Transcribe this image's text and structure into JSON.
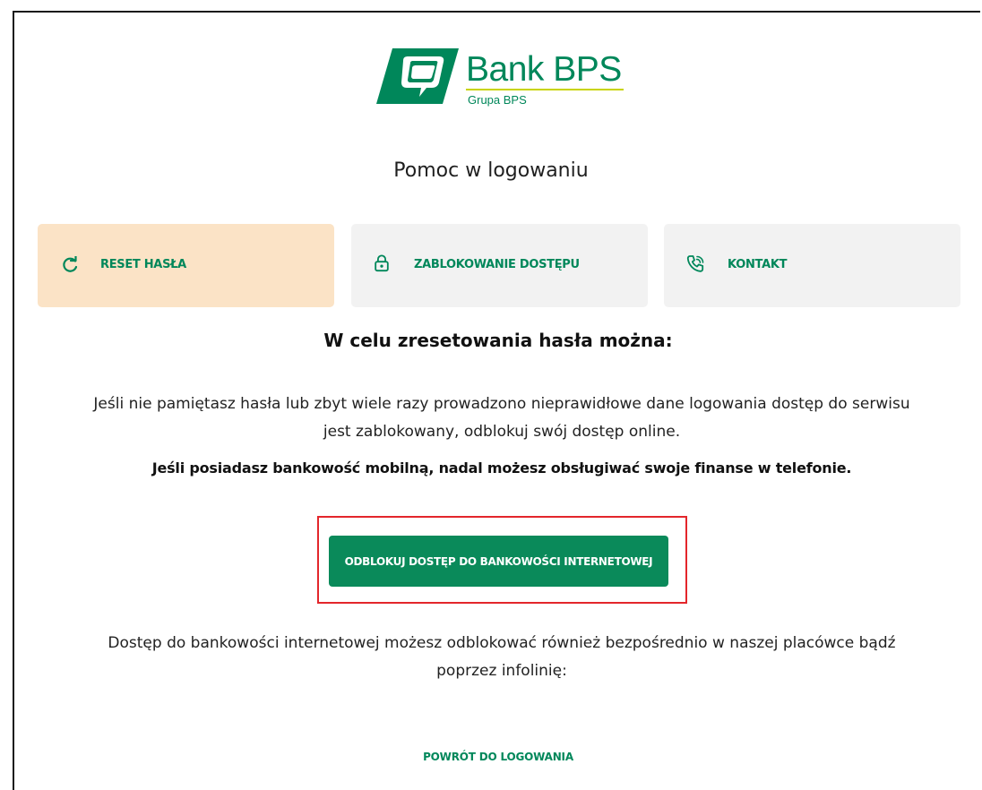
{
  "brand": {
    "name": "Bank BPS",
    "subtitle": "Grupa BPS",
    "logo_icon": "bps-logo-icon",
    "primary_color": "#00875a",
    "accent_line_color": "#c8d400"
  },
  "page_title": "Pomoc w logowaniu",
  "tabs": [
    {
      "label": "RESET HASŁA",
      "icon": "refresh-icon",
      "active": true
    },
    {
      "label": "ZABLOKOWANIE DOSTĘPU",
      "icon": "lock-icon",
      "active": false
    },
    {
      "label": "KONTAKT",
      "icon": "phone-icon",
      "active": false
    }
  ],
  "content": {
    "heading": "W celu zresetowania hasła można:",
    "paragraph_1_line_1": "Jeśli nie pamiętasz hasła lub zbyt wiele razy prowadzono nieprawidłowe dane logowania dostęp do serwisu",
    "paragraph_1_line_2": "jest zablokowany, odblokuj swój dostęp online.",
    "bold_note": "Jeśli posiadasz bankowość mobilną, nadal możesz obsługiwać swoje finanse w telefonie.",
    "unlock_button_label": "ODBLOKUJ DOSTĘP DO BANKOWOŚCI INTERNETOWEJ",
    "paragraph_2_line_1": "Dostęp do bankowości internetowej możesz odblokować również bezpośrednio w naszej placówce bądź",
    "paragraph_2_line_2": "poprzez infolinię:",
    "back_link_label": "POWRÓT DO LOGOWANIA"
  },
  "colors": {
    "active_tab_bg": "#fbe3c6",
    "inactive_tab_bg": "#f2f2f2",
    "highlight_border": "#e3262b",
    "button_bg": "#0a8a5a"
  }
}
